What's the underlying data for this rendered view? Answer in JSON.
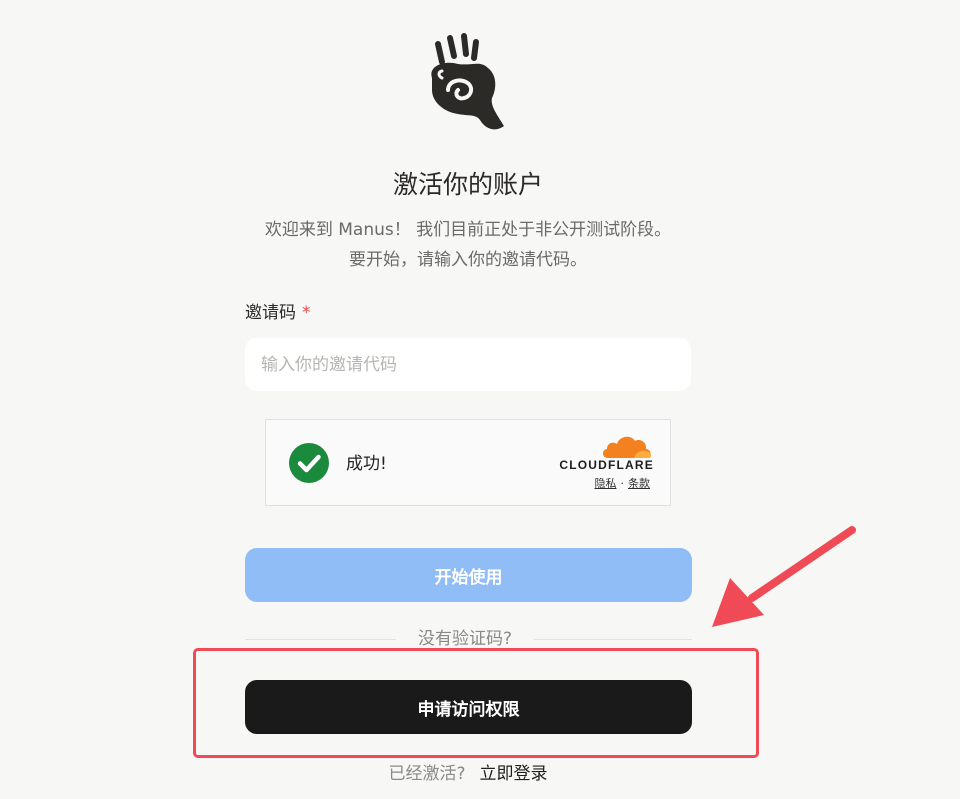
{
  "header": {
    "title": "激活你的账户",
    "subtitle_line1": "欢迎来到 Manus！ 我们目前正处于非公开测试阶段。",
    "subtitle_line2": "要开始，请输入你的邀请代码。"
  },
  "form": {
    "invite_label": "邀请码",
    "required_marker": "*",
    "invite_placeholder": "输入你的邀请代码",
    "invite_value": ""
  },
  "captcha": {
    "status_text": "成功!",
    "provider": "CLOUDFLARE",
    "privacy_link": "隐私",
    "separator": "·",
    "terms_link": "条款",
    "status_color": "#1c8a3c",
    "brand_color": "#f48120"
  },
  "actions": {
    "start_button": "开始使用",
    "divider_text": "没有验证码?",
    "apply_button": "申请访问权限",
    "already_activated": "已经激活?",
    "login_link": "立即登录"
  },
  "annotation": {
    "color": "#ef4a55"
  }
}
